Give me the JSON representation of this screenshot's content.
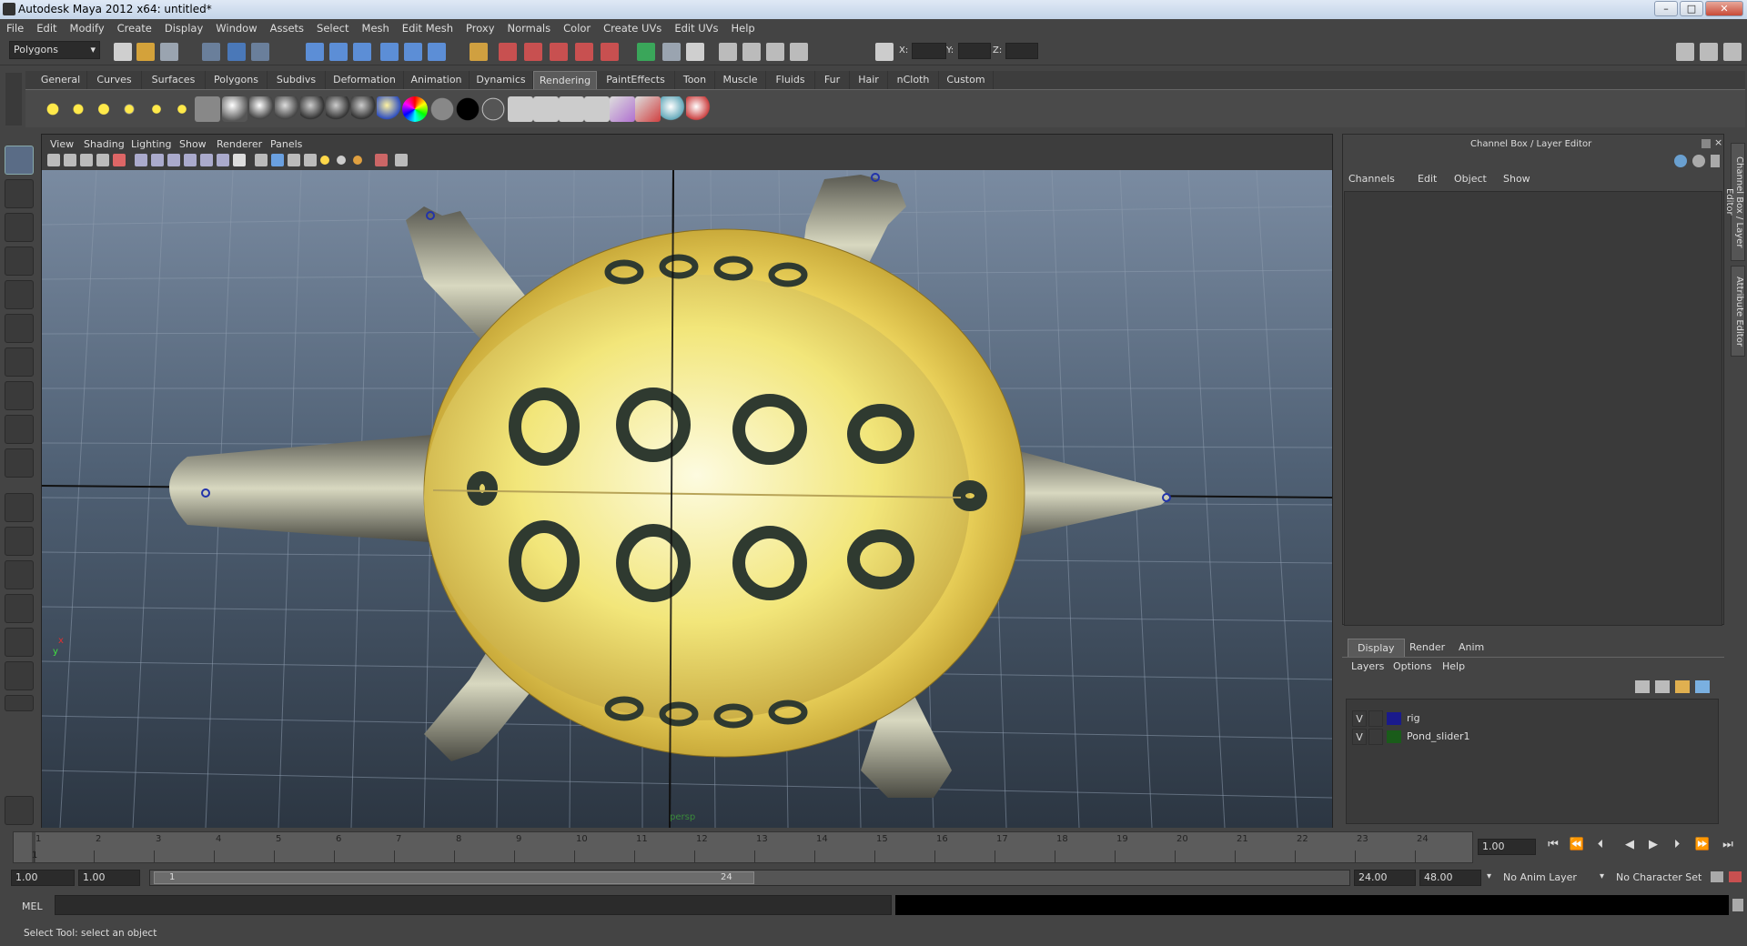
{
  "window": {
    "title": "Autodesk Maya 2012 x64: untitled*",
    "minimize": "–",
    "maximize": "□",
    "close": "✕"
  },
  "menubar": [
    "File",
    "Edit",
    "Modify",
    "Create",
    "Display",
    "Window",
    "Assets",
    "Select",
    "Mesh",
    "Edit Mesh",
    "Proxy",
    "Normals",
    "Color",
    "Create UVs",
    "Edit UVs",
    "Help"
  ],
  "status_line": {
    "menu_set": "Polygons",
    "x_label": "X:",
    "y_label": "Y:",
    "z_label": "Z:",
    "x_value": "",
    "y_value": "",
    "z_value": ""
  },
  "shelf_tabs": [
    "General",
    "Curves",
    "Surfaces",
    "Polygons",
    "Subdivs",
    "Deformation",
    "Animation",
    "Dynamics",
    "Rendering",
    "PaintEffects",
    "Toon",
    "Muscle",
    "Fluids",
    "Fur",
    "Hair",
    "nCloth",
    "Custom"
  ],
  "shelf_active_tab": "Rendering",
  "viewport": {
    "menus": [
      "View",
      "Shading",
      "Lighting",
      "Show",
      "Renderer",
      "Panels"
    ],
    "camera_label": "persp",
    "axis_x": "x",
    "axis_y": "y"
  },
  "channel_box": {
    "title": "Channel Box / Layer Editor",
    "menus": [
      "Channels",
      "Edit",
      "Object",
      "Show"
    ]
  },
  "side_tabs": [
    "Channel Box / Layer Editor",
    "Attribute Editor"
  ],
  "layer_editor": {
    "tabs": [
      "Display",
      "Render",
      "Anim"
    ],
    "active_tab": "Display",
    "menus": [
      "Layers",
      "Options",
      "Help"
    ],
    "layers": [
      {
        "visible": "V",
        "name": "rig",
        "color": "#1a1a8c"
      },
      {
        "visible": "V",
        "name": "Pond_slider1",
        "color": "#1a5c1a"
      }
    ]
  },
  "time_slider": {
    "ticks": [
      "1",
      "2",
      "3",
      "4",
      "5",
      "6",
      "7",
      "8",
      "9",
      "10",
      "11",
      "12",
      "13",
      "14",
      "15",
      "16",
      "17",
      "18",
      "19",
      "20",
      "21",
      "22",
      "23",
      "24"
    ],
    "current_frame_marker": "1",
    "current_time": "1.00"
  },
  "range_slider": {
    "start_time": "1.00",
    "playback_start": "1.00",
    "range_min_label": "1",
    "range_max_label": "24",
    "playback_end": "24.00",
    "end_time": "48.00",
    "anim_layer": "No Anim Layer",
    "character_set": "No Character Set"
  },
  "command_line": {
    "label": "MEL",
    "value": ""
  },
  "help_line": "Select Tool: select an object"
}
